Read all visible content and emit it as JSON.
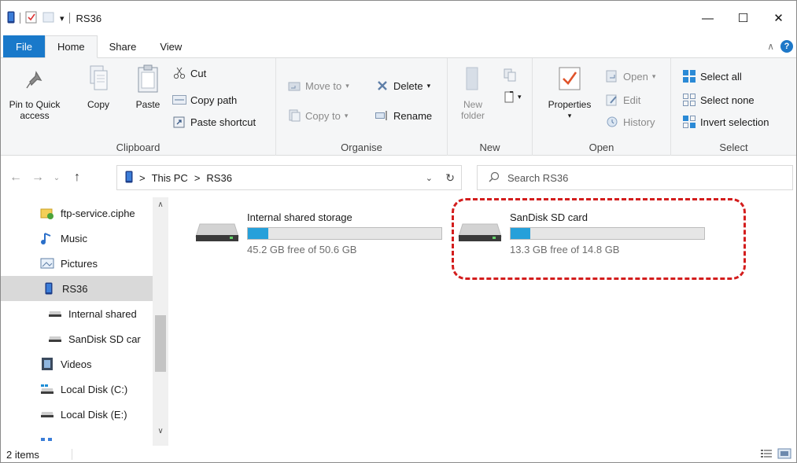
{
  "window": {
    "title": "RS36"
  },
  "controls": {
    "minimize": "—",
    "maximize": "☐",
    "close": "✕"
  },
  "tabs": {
    "file": "File",
    "home": "Home",
    "share": "Share",
    "view": "View",
    "help": "?"
  },
  "ribbon": {
    "clipboard": {
      "label": "Clipboard",
      "pin_line1": "Pin to Quick",
      "pin_line2": "access",
      "copy": "Copy",
      "paste": "Paste",
      "cut": "Cut",
      "copy_path": "Copy path",
      "paste_shortcut": "Paste shortcut"
    },
    "organise": {
      "label": "Organise",
      "move_to": "Move to",
      "copy_to": "Copy to",
      "delete": "Delete",
      "rename": "Rename"
    },
    "new": {
      "label": "New",
      "new_folder_line1": "New",
      "new_folder_line2": "folder"
    },
    "open": {
      "label": "Open",
      "properties": "Properties",
      "open": "Open",
      "edit": "Edit",
      "history": "History"
    },
    "select": {
      "label": "Select",
      "select_all": "Select all",
      "select_none": "Select none",
      "invert_selection": "Invert selection"
    }
  },
  "address": {
    "crumb_1": "This PC",
    "crumb_2": "RS36",
    "sep": ">",
    "search_placeholder": "Search RS36"
  },
  "nav": {
    "items": [
      {
        "label": "ftp-service.ciphe"
      },
      {
        "label": "Music"
      },
      {
        "label": "Pictures"
      },
      {
        "label": "RS36"
      },
      {
        "label": "Internal shared"
      },
      {
        "label": "SanDisk SD car"
      },
      {
        "label": "Videos"
      },
      {
        "label": "Local Disk (C:)"
      },
      {
        "label": "Local Disk (E:)"
      }
    ]
  },
  "drives": [
    {
      "name": "Internal shared storage",
      "free_text": "45.2 GB free of 50.6 GB",
      "used_fraction": 0.107
    },
    {
      "name": "SanDisk SD card",
      "free_text": "13.3 GB free of 14.8 GB",
      "used_fraction": 0.101
    }
  ],
  "status": {
    "items": "2 items"
  },
  "colors": {
    "accent": "#1979ca",
    "bar_fill": "#26a0da",
    "highlight": "#d31d1d"
  }
}
